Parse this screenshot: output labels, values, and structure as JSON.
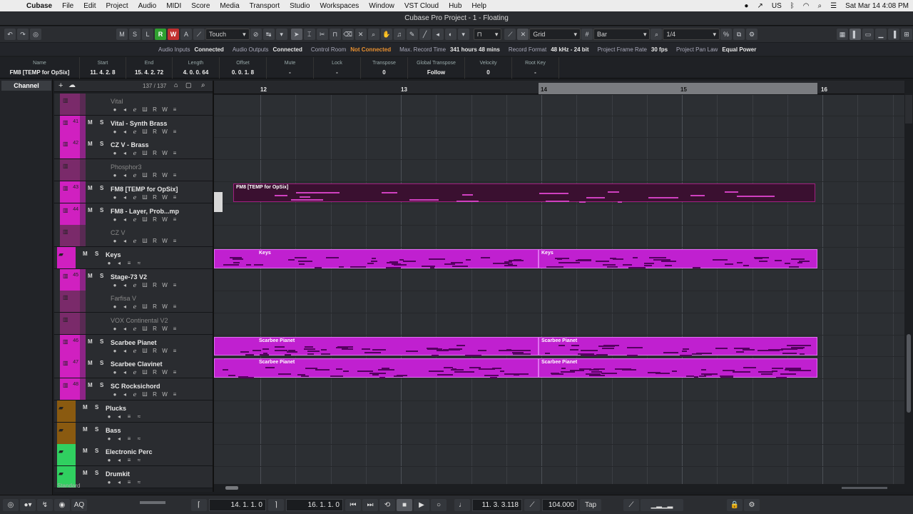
{
  "menubar": {
    "items": [
      "Cubase",
      "File",
      "Edit",
      "Project",
      "Audio",
      "MIDI",
      "Score",
      "Media",
      "Transport",
      "Studio",
      "Workspaces",
      "Window",
      "VST Cloud",
      "Hub",
      "Help"
    ],
    "lang": "US",
    "datetime": "Sat Mar 14  4:08 PM"
  },
  "window": {
    "title": "Cubase Pro Project - 1 - Floating"
  },
  "toolbar": {
    "m": "M",
    "s": "S",
    "l": "L",
    "r": "R",
    "w": "W",
    "a": "A",
    "automation_mode": "Touch",
    "grid_type": "Grid",
    "grid_unit": "Bar",
    "quantize": "1/4"
  },
  "status": [
    {
      "label": "Audio Inputs",
      "value": "Connected"
    },
    {
      "label": "Audio Outputs",
      "value": "Connected"
    },
    {
      "label": "Control Room",
      "value": "Not Connected"
    },
    {
      "label": "Max. Record Time",
      "value": "341 hours 48 mins"
    },
    {
      "label": "Record Format",
      "value": "48 kHz - 24 bit"
    },
    {
      "label": "Project Frame Rate",
      "value": "30 fps"
    },
    {
      "label": "Project Pan Law",
      "value": "Equal Power"
    }
  ],
  "infoline": [
    {
      "label": "Name",
      "value": "FM8 [TEMP for OpSix]"
    },
    {
      "label": "Start",
      "value": "11. 4. 2.  8"
    },
    {
      "label": "End",
      "value": "15. 4. 2. 72"
    },
    {
      "label": "Length",
      "value": "4. 0. 0. 64"
    },
    {
      "label": "Offset",
      "value": "0. 0. 1.  8"
    },
    {
      "label": "Mute",
      "value": "-"
    },
    {
      "label": "Lock",
      "value": "-"
    },
    {
      "label": "Transpose",
      "value": "0"
    },
    {
      "label": "Global Transpose",
      "value": "Follow"
    },
    {
      "label": "Velocity",
      "value": "0"
    },
    {
      "label": "Root Key",
      "value": "-"
    }
  ],
  "left": {
    "tab": "Channel"
  },
  "tracklist": {
    "count": "137 / 137",
    "footer": "Standard"
  },
  "tracks": [
    {
      "num": "",
      "name": "Vital",
      "disabled": true,
      "color": "#7a2a6a",
      "kind": "inst"
    },
    {
      "num": "41",
      "name": "Vital - Synth Brass",
      "disabled": false,
      "color": "#d020c0",
      "kind": "inst"
    },
    {
      "num": "42",
      "name": "CZ V - Brass",
      "disabled": false,
      "color": "#d020c0",
      "kind": "inst"
    },
    {
      "num": "",
      "name": "Phosphor3",
      "disabled": true,
      "color": "#7a2a6a",
      "kind": "inst"
    },
    {
      "num": "43",
      "name": "FM8 [TEMP for OpSix]",
      "disabled": false,
      "color": "#d020c0",
      "kind": "inst"
    },
    {
      "num": "44",
      "name": "FM8 - Layer, Prob...mp",
      "disabled": false,
      "color": "#d020c0",
      "kind": "inst"
    },
    {
      "num": "",
      "name": "CZ V",
      "disabled": true,
      "color": "#7a2a6a",
      "kind": "inst"
    },
    {
      "num": "",
      "name": "Keys",
      "disabled": false,
      "color": "#d020c0",
      "kind": "folder"
    },
    {
      "num": "45",
      "name": "Stage-73 V2",
      "disabled": false,
      "color": "#d020c0",
      "kind": "inst"
    },
    {
      "num": "",
      "name": "Farfisa V",
      "disabled": true,
      "color": "#7a2a6a",
      "kind": "inst"
    },
    {
      "num": "",
      "name": "VOX Continental V2",
      "disabled": true,
      "color": "#7a2a6a",
      "kind": "inst"
    },
    {
      "num": "46",
      "name": "Scarbee Pianet",
      "disabled": false,
      "color": "#d020c0",
      "kind": "inst"
    },
    {
      "num": "47",
      "name": "Scarbee Clavinet",
      "disabled": false,
      "color": "#d020c0",
      "kind": "inst"
    },
    {
      "num": "48",
      "name": "SC Rocksichord",
      "disabled": false,
      "color": "#d020c0",
      "kind": "inst"
    },
    {
      "num": "",
      "name": "Plucks",
      "disabled": false,
      "color": "#8a5a10",
      "kind": "folder"
    },
    {
      "num": "",
      "name": "Bass",
      "disabled": false,
      "color": "#8a5a10",
      "kind": "folder"
    },
    {
      "num": "",
      "name": "Electronic Perc",
      "disabled": false,
      "color": "#30d060",
      "kind": "folder"
    },
    {
      "num": "",
      "name": "Drumkit",
      "disabled": false,
      "color": "#30d060",
      "kind": "folder"
    }
  ],
  "ruler": {
    "bars": [
      "12",
      "13",
      "14",
      "15",
      "16"
    ]
  },
  "parts": [
    {
      "label": "FM8 [TEMP for OpSix]",
      "row": 4,
      "dark": true
    },
    {
      "label": "Keys",
      "row": 7
    },
    {
      "label": "Keys",
      "row": 7
    },
    {
      "label": "Scarbee Pianet",
      "row": 11
    },
    {
      "label": "Scarbee Pianet",
      "row": 11
    },
    {
      "label": "Scarbee Pianet",
      "row": 12
    },
    {
      "label": "Scarbee Pianet",
      "row": 12
    }
  ],
  "transport": {
    "left_locator": "14. 1. 1.   0",
    "right_locator": "16. 1. 1.   0",
    "position": "11. 3. 3.118",
    "tempo": "104.000",
    "tap": "Tap"
  }
}
